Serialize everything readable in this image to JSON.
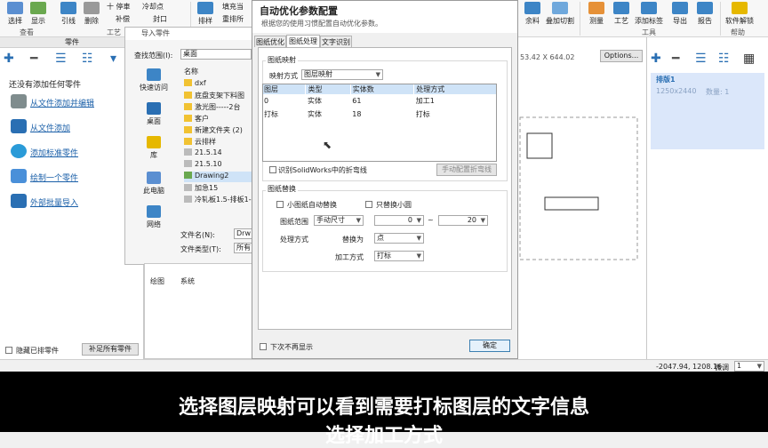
{
  "ribbon": {
    "buttons": [
      "选择",
      "显示",
      "引线",
      "删除",
      "排样",
      "余料",
      "叠加切割",
      "测量",
      "工艺",
      "添加标签",
      "导出",
      "报告",
      "软件解锁"
    ],
    "small_items": [
      "十 停車",
      "冷却点",
      "补偿",
      "封口",
      "填充当",
      "重排所"
    ],
    "groups": [
      "查看",
      "工艺",
      "工具",
      "帮助"
    ]
  },
  "parts_panel": {
    "header": "零件",
    "empty_text": "还没有添加任何零件",
    "actions": [
      "从文件添加并编辑",
      "从文件添加",
      "添加标准零件",
      "绘制一个零件",
      "外部批量导入"
    ],
    "hide_label": "隐藏已排零件",
    "fill_button": "补足所有零件"
  },
  "import_dialog": {
    "title": "导入零件",
    "lookin_label": "查找范围(I):",
    "lookin_value": "桌面",
    "name_header": "名称",
    "nav": [
      "快速访问",
      "桌面",
      "库",
      "此电脑",
      "网络"
    ],
    "files": [
      "dxf",
      "底盘支架下料图",
      "激光图-----2台",
      "客户",
      "新建文件夹 (2)",
      "云排样",
      "21.5.14",
      "21.5.10",
      "Drawing2",
      "加急15",
      "冷轧板1.5-排板1-"
    ],
    "filename_label": "文件名(N):",
    "filename_value": "Drw",
    "filetype_label": "文件类型(T):",
    "filetype_value": "所有"
  },
  "opt_dialog": {
    "title": "自动优化参数配置",
    "subtitle": "根据您的使用习惯配置自动优化参数。",
    "tabs": [
      "图纸优化",
      "图纸处理",
      "文字识别"
    ],
    "mapping_group": "图纸映射",
    "mapping_mode_label": "映射方式",
    "mapping_mode_value": "图层映射",
    "table_headers": [
      "图层",
      "类型",
      "实体数",
      "处理方式"
    ],
    "table_rows": [
      [
        "0",
        "实体",
        "61",
        "加工1"
      ],
      [
        "打标",
        "实体",
        "18",
        "打标"
      ]
    ],
    "identify_label": "识别SolidWorks中的折弯线",
    "manual_bend_button": "手动配置折弯线",
    "replace_group": "图纸替换",
    "small_auto_label": "小图纸自动替换",
    "only_small_circle_label": "只替换小圆",
    "range_label": "图纸范围",
    "range_mode": "手动尺寸",
    "range_from": "0",
    "range_sep": "~",
    "range_to": "20",
    "process_label": "处理方式",
    "replace_as_label": "替换为",
    "replace_as_value": "点",
    "process_mode_label": "加工方式",
    "process_mode_value": "打标",
    "no_show_label": "下次不再显示",
    "ok_button": "确定"
  },
  "drawing": {
    "coords_top": "53.42 X 644.02",
    "options_button": "Options..."
  },
  "right_panel": {
    "sheet_title": "排版1",
    "sheet_size": "1250x2440",
    "count": "数量: 1"
  },
  "bottom_tabs": [
    "绘图",
    "系统"
  ],
  "status": {
    "coords": "-2047.94, 1208.16",
    "mode": "微调",
    "step": "1"
  },
  "subtitles": {
    "line1": "选择图层映射可以看到需要打标图层的文字信息",
    "line2": "选择加工方式"
  },
  "colors": {
    "accent": "#2a6fb3",
    "selection": "#cfe3f7",
    "right_highlight": "#dbe7fa"
  }
}
